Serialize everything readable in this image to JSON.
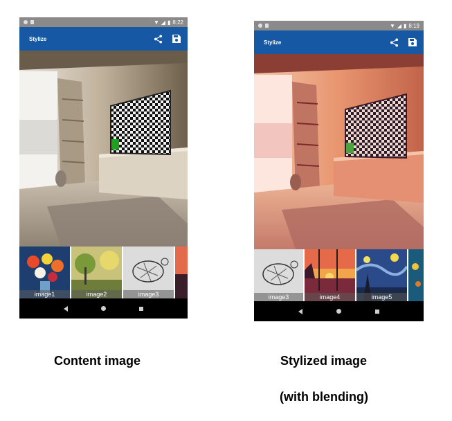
{
  "left_phone": {
    "status_time": "8:22",
    "app_title": "Stylize",
    "thumbnails": [
      {
        "label": "image1",
        "style": "flowers"
      },
      {
        "label": "image2",
        "style": "landscape"
      },
      {
        "label": "image3",
        "style": "turtle-sketch"
      },
      {
        "label": "",
        "style": "sunset-partial"
      }
    ]
  },
  "right_phone": {
    "status_time": "8:19",
    "app_title": "Stylize",
    "thumbnails": [
      {
        "label": "image3",
        "style": "turtle-sketch"
      },
      {
        "label": "image4",
        "style": "sunset"
      },
      {
        "label": "image5",
        "style": "starry-night"
      },
      {
        "label": "",
        "style": "fish-partial"
      }
    ]
  },
  "captions": {
    "left": "Content image",
    "right_line1": "Stylized image",
    "right_line2": "(with blending)"
  },
  "icons": {
    "share": "share-icon",
    "save": "save-icon",
    "back": "back-icon",
    "home": "home-icon",
    "recents": "recents-icon"
  },
  "colors": {
    "appbar": "#1758a4",
    "statusbar": "#8a8a8a"
  }
}
